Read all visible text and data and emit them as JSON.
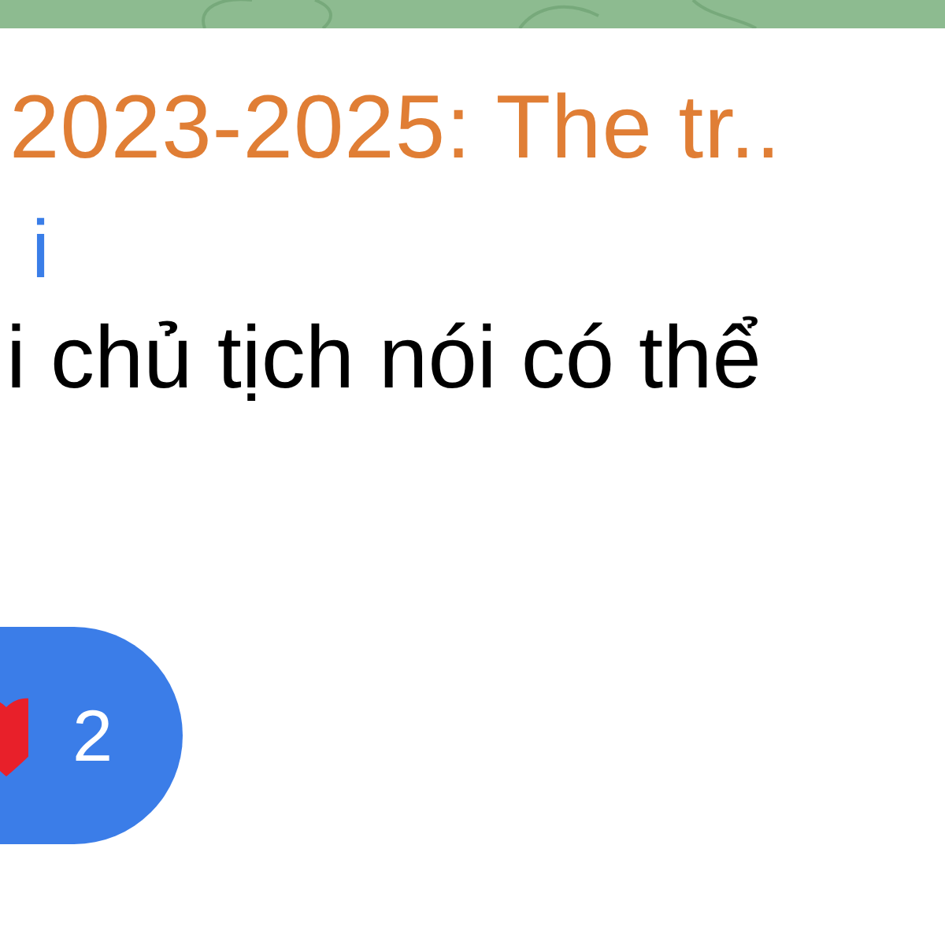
{
  "reply_preview": {
    "title": "2023-2025: The tr.."
  },
  "message": {
    "sender": "i",
    "text": "i chủ tịch nói có thể"
  },
  "reactions": [
    {
      "kind": "heart",
      "count": "2",
      "selected": true
    }
  ]
}
